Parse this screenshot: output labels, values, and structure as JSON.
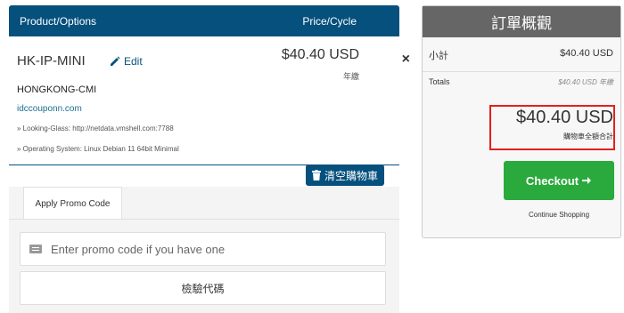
{
  "cart": {
    "header_product": "Product/Options",
    "header_price": "Price/Cycle",
    "item": {
      "name": "HK-IP-MINI",
      "edit_label": "Edit",
      "price": "$40.40 USD",
      "cycle": "年繳",
      "remove_symbol": "×",
      "group": "HONGKONG-CMI",
      "domain": "idccouponn.com",
      "options": [
        "» Looking-Glass: http://netdata.vmshell.com:7788",
        "» Operating System: Linux Debian 11 64bit Minimal"
      ]
    },
    "empty_cart_label": "清空購物車"
  },
  "promo": {
    "tab_label": "Apply Promo Code",
    "placeholder": "Enter promo code if you have one",
    "validate_label": "檢驗代碼"
  },
  "summary": {
    "title": "訂單概觀",
    "subtotal_label": "小計",
    "subtotal_value": "$40.40 USD",
    "totals_label": "Totals",
    "totals_value": "$40.40 USD 年繳",
    "total_due": "$40.40 USD",
    "total_due_label": "購物車全額合計",
    "checkout_label": "Checkout",
    "continue_label": "Continue Shopping"
  },
  "colors": {
    "header_blue": "#05507d",
    "summary_header": "#666666",
    "checkout_green": "#2aaa3c",
    "highlight_red": "#e02020"
  }
}
